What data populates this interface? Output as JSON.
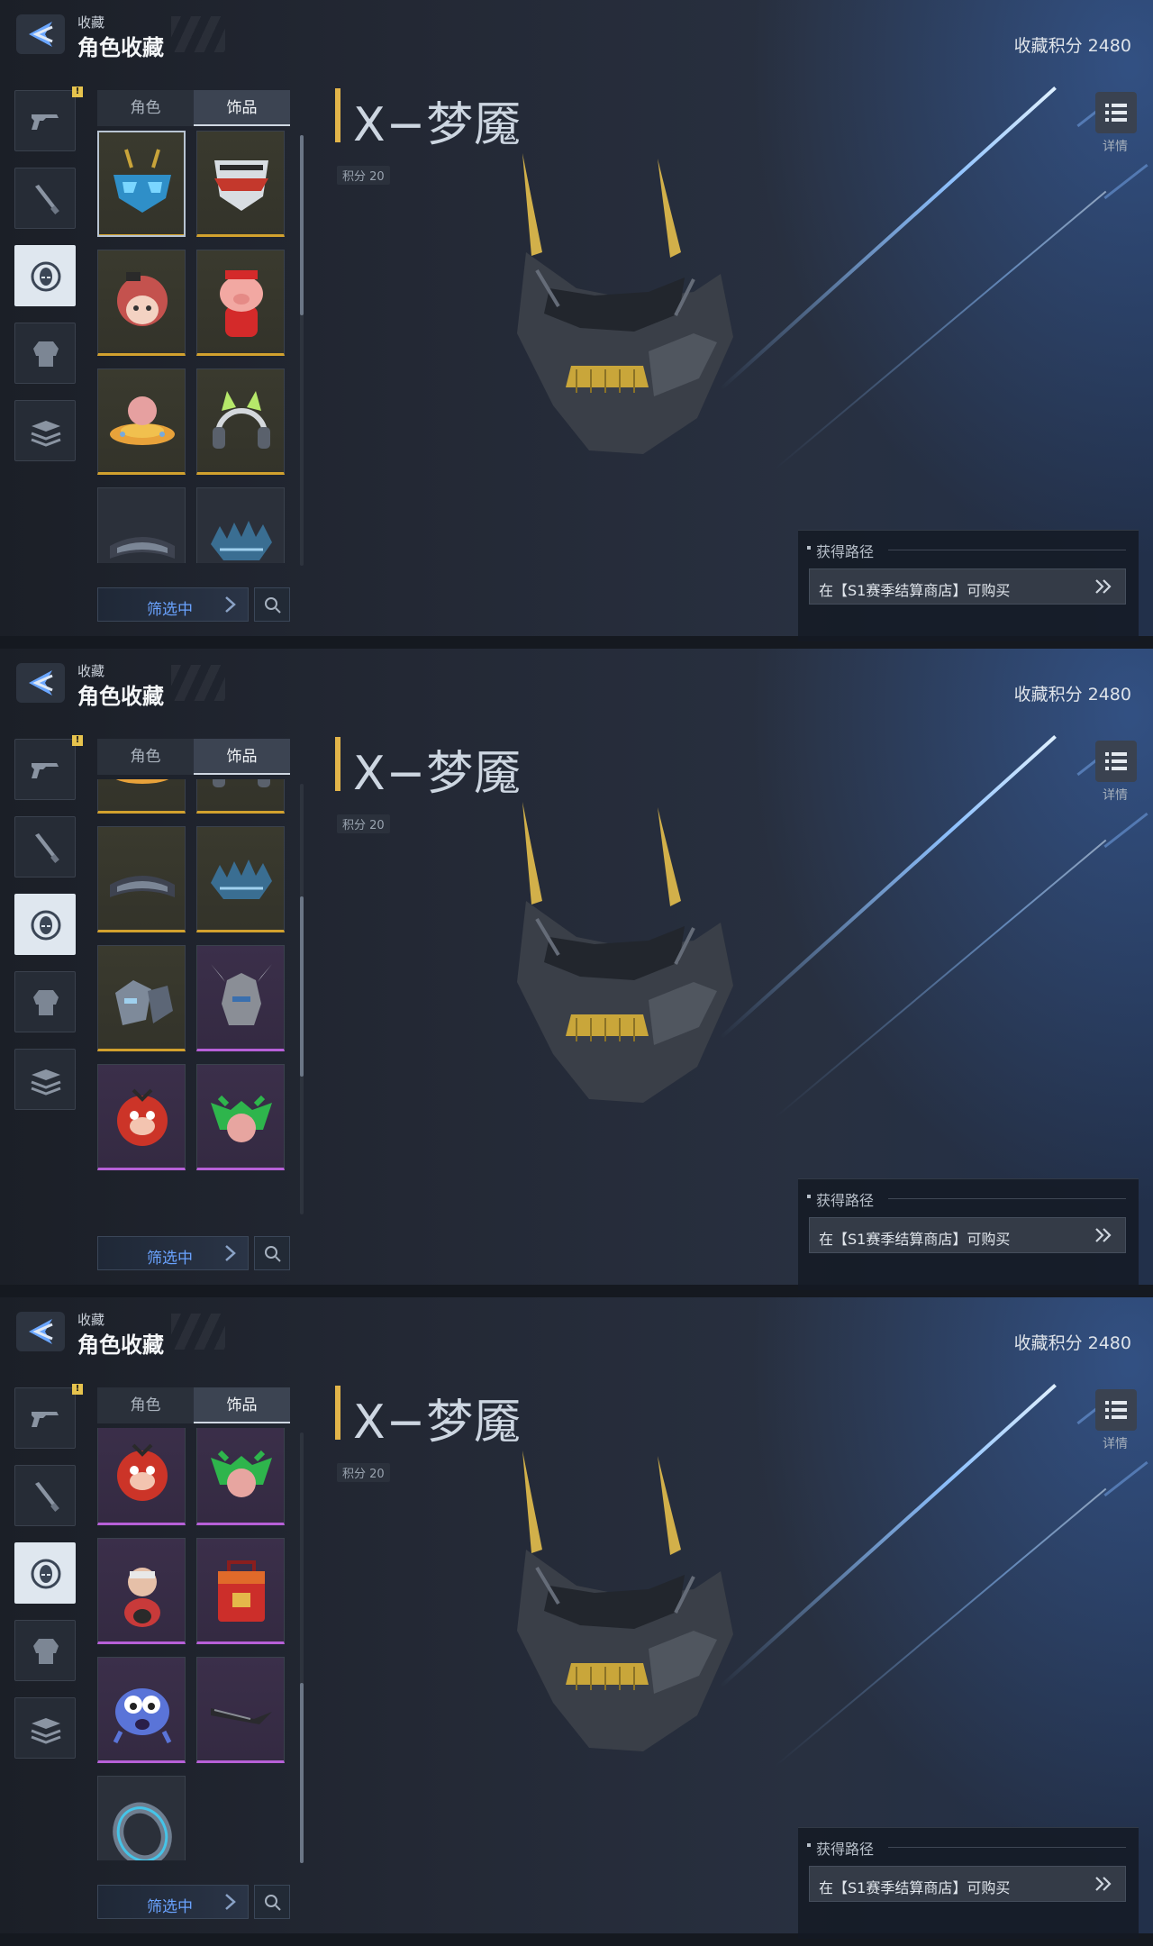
{
  "header": {
    "section": "收藏",
    "title": "角色收藏",
    "score_text": "收藏积分 2480"
  },
  "tabs": [
    {
      "label": "角色"
    },
    {
      "label": "饰品"
    }
  ],
  "filter": {
    "label": "筛选中"
  },
  "item": {
    "name": "X−梦魇",
    "points": "积分 20"
  },
  "detail_button": {
    "label": "详情"
  },
  "acquisition": {
    "heading": "获得路径",
    "method": "在【S1赛季结算商店】可购买"
  },
  "nav_items": [
    {
      "icon": "pistol-icon"
    },
    {
      "icon": "melee-weapon-icon"
    },
    {
      "icon": "character-head-icon"
    },
    {
      "icon": "armor-body-icon"
    },
    {
      "icon": "stacked-items-icon"
    }
  ],
  "nav_alert": "!",
  "screens": [
    {
      "grid": [
        "mask-blue",
        "mask-red-white",
        "hair-girl",
        "pig-red",
        "ufo-pig",
        "headphones-cat",
        "goggles",
        "spiked-mask"
      ],
      "rarity": [
        "gold",
        "gold",
        "gold",
        "gold",
        "gold",
        "gold",
        "dark",
        "dark"
      ],
      "scroll_fraction": 0.0
    },
    {
      "grid": [
        "ufo-pig",
        "headphones-cat",
        "goggles",
        "spiked-mask",
        "shoulder-armor",
        "helmet-horned",
        "bird-pig",
        "green-pig"
      ],
      "rarity": [
        "gold",
        "gold",
        "gold",
        "gold",
        "gold",
        "purple",
        "purple",
        "purple"
      ],
      "scroll_fraction": 0.45
    },
    {
      "grid": [
        "bird-pig",
        "green-pig",
        "grandpa-figure",
        "red-backpack",
        "blue-creature",
        "black-hook",
        "blue-ring"
      ],
      "rarity": [
        "purple",
        "purple",
        "purple",
        "purple",
        "purple",
        "purple",
        "dark"
      ],
      "scroll_fraction": 1.0
    }
  ]
}
